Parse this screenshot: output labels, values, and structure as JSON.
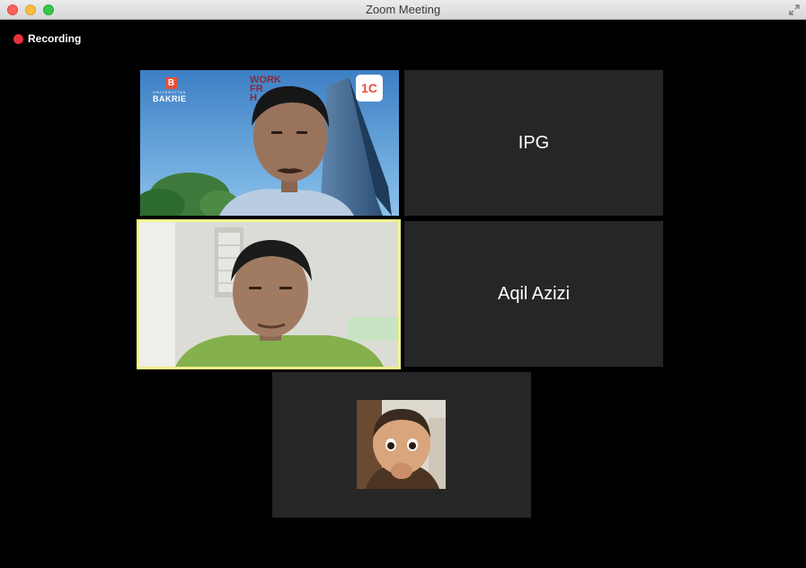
{
  "window": {
    "title": "Zoom Meeting"
  },
  "recording": {
    "label": "Recording",
    "color": "#e8323b"
  },
  "gallery": {
    "tiles": [
      {
        "kind": "video",
        "background_text": {
          "logo_sub": "UNIVERSITAS",
          "logo_name": "BAKRIE",
          "logo_mark": "B",
          "wfh_lines": [
            "WORK",
            "FR",
            "H"
          ],
          "badge": "1C"
        }
      },
      {
        "kind": "name",
        "name": "IPG"
      },
      {
        "kind": "video",
        "active_speaker": true
      },
      {
        "kind": "name",
        "name": "Aqil Azizi"
      },
      {
        "kind": "avatar"
      }
    ]
  },
  "colors": {
    "active_speaker_border": "#f3f38a",
    "tile_background": "#262626"
  },
  "icons": [
    "close-icon",
    "minimize-icon",
    "maximize-icon",
    "fullscreen-icon",
    "record-icon"
  ]
}
